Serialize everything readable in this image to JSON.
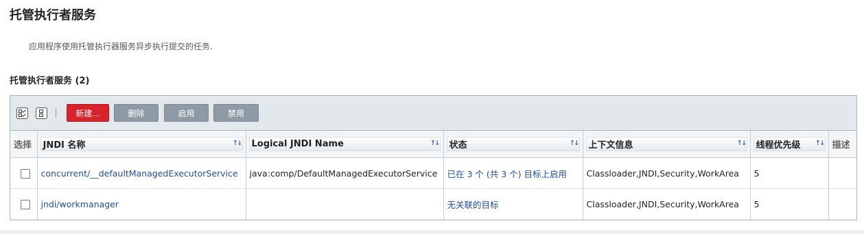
{
  "page": {
    "title": "托管执行者服务",
    "description": "应用程序使用托管执行器服务异步执行提交的任务."
  },
  "section": {
    "title": "托管执行者服务 (2)"
  },
  "toolbar": {
    "select_all_icon": "select-all-icon",
    "deselect_icon": "deselect-all-icon",
    "buttons": {
      "new": "新建...",
      "delete": "删除",
      "enable": "启用",
      "disable": "禁用"
    }
  },
  "table": {
    "columns": {
      "select": "选择",
      "jndi": "JNDI 名称",
      "logical": "Logical JNDI Name",
      "status": "状态",
      "context": "上下文信息",
      "priority": "线程优先级",
      "description": "描述"
    },
    "sort_icon": "↑↓",
    "rows": [
      {
        "jndi": "concurrent/__defaultManagedExecutorService",
        "logical": "java:comp/DefaultManagedExecutorService",
        "status": "已在 3 个 (共 3 个) 目标上启用",
        "context": "Classloader,JNDI,Security,WorkArea",
        "priority": "5",
        "description": ""
      },
      {
        "jndi": "jndi/workmanager",
        "logical": "",
        "status": "无关联的目标",
        "context": "Classloader,JNDI,Security,WorkArea",
        "priority": "5",
        "description": ""
      }
    ]
  },
  "colors": {
    "primary_button": "#d8232a",
    "secondary_button": "#8e9ba4",
    "link": "#1f4e9c",
    "toolbar_bg": "#e3e8ec"
  }
}
